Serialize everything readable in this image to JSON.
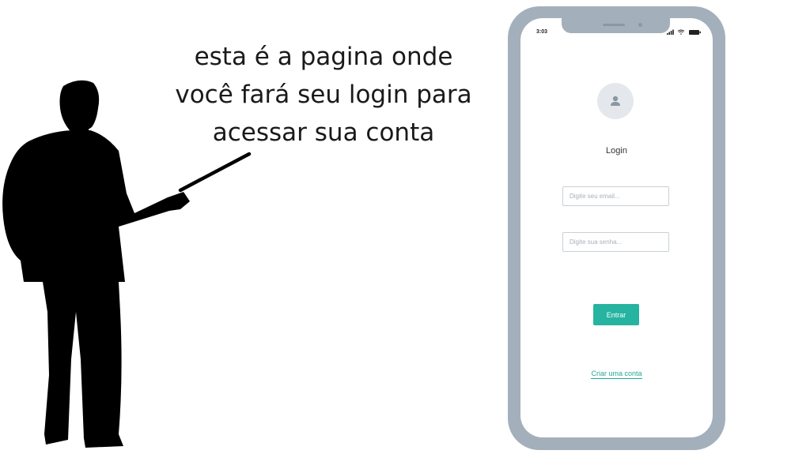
{
  "speech": {
    "lines": [
      "esta é a pagina onde",
      "você fará seu login para",
      "acessar sua conta"
    ]
  },
  "phone": {
    "status_time": "3:03",
    "status_icons": [
      "signal-icon",
      "wifi-icon",
      "battery-icon"
    ],
    "avatar_icon": "user-icon",
    "login_title": "Login",
    "email_placeholder": "Digite seu email...",
    "password_placeholder": "Digite sua senha...",
    "enter_button": "Entrar",
    "create_account_link": "Criar uma conta"
  },
  "colors": {
    "phone_frame": "#a3b0bb",
    "accent": "#26b3a0",
    "silhouette": "#000000"
  }
}
